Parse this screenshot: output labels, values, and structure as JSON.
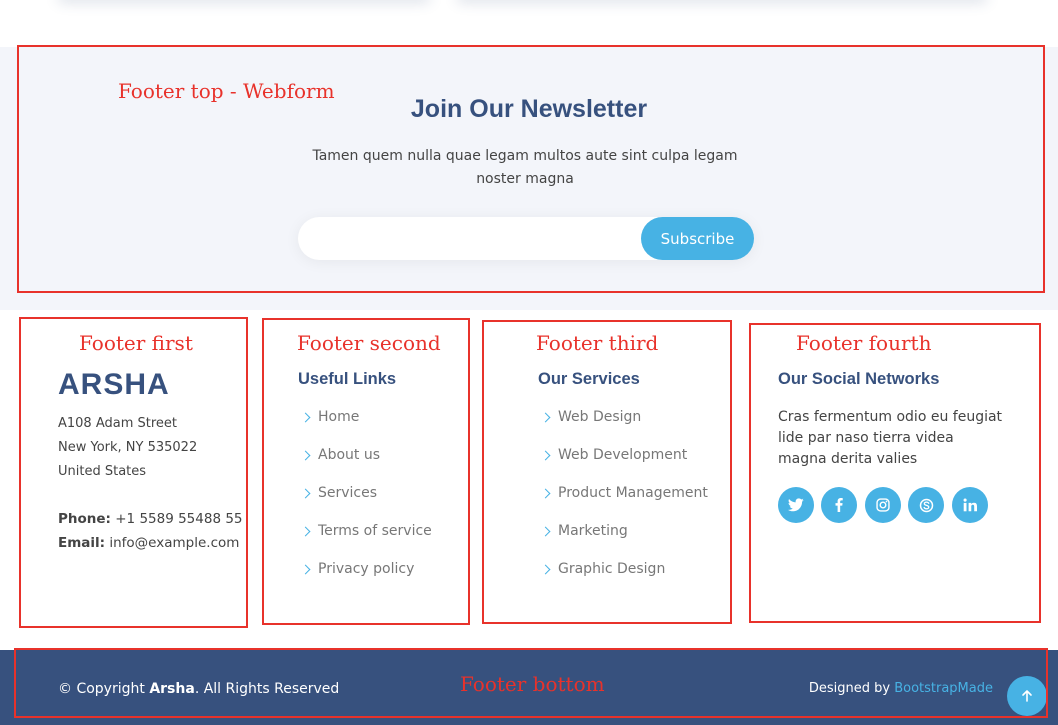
{
  "newsletter": {
    "title": "Join Our Newsletter",
    "description": "Tamen quem nulla quae legam multos aute sint culpa legam noster magna",
    "email_placeholder": "",
    "subscribe_label": "Subscribe"
  },
  "annotations": {
    "footer_top": "Footer top - Webform",
    "footer_first": "Footer first",
    "footer_second": "Footer second",
    "footer_third": "Footer third",
    "footer_fourth": "Footer fourth",
    "footer_bottom": "Footer bottom",
    "color": "#e8322b"
  },
  "footer_first": {
    "brand": "ARSHA",
    "address_lines": [
      "A108 Adam Street",
      "New York, NY 535022",
      "United States"
    ],
    "phone_label": "Phone:",
    "phone": "+1 5589 55488 55",
    "email_label": "Email:",
    "email": "info@example.com"
  },
  "useful_links": {
    "title": "Useful Links",
    "items": [
      "Home",
      "About us",
      "Services",
      "Terms of service",
      "Privacy policy"
    ]
  },
  "services": {
    "title": "Our Services",
    "items": [
      "Web Design",
      "Web Development",
      "Product Management",
      "Marketing",
      "Graphic Design"
    ]
  },
  "social": {
    "title": "Our Social Networks",
    "description": "Cras fermentum odio eu feugiat lide par naso tierra videa magna derita valies",
    "networks": [
      "twitter-icon",
      "facebook-icon",
      "instagram-icon",
      "skype-icon",
      "linkedin-icon"
    ]
  },
  "footer_bottom": {
    "copyright_prefix": "© Copyright ",
    "copyright_brand": "Arsha",
    "copyright_suffix": ". All Rights Reserved",
    "designed_by": "Designed by ",
    "designer": "BootstrapMade"
  },
  "colors": {
    "primary": "#37517e",
    "accent": "#47b2e4",
    "newsletter_bg": "#f3f5fa"
  }
}
